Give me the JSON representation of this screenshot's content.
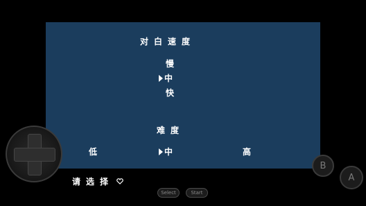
{
  "dialog_speed": {
    "title": "对白速度",
    "options": [
      "慢",
      "中",
      "快"
    ],
    "selected": "中"
  },
  "difficulty": {
    "title": "难度",
    "options": [
      "低",
      "中",
      "高"
    ],
    "selected": "中"
  },
  "prompt": {
    "text": "请选择",
    "icon": "heart-outline-icon"
  },
  "controls": {
    "b_label": "B",
    "a_label": "A",
    "select_label": "Select",
    "start_label": "Start"
  }
}
